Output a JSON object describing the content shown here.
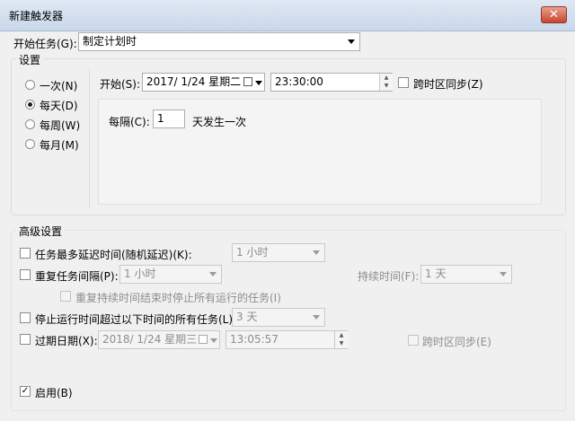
{
  "window": {
    "title": "新建触发器",
    "close_label": "✕"
  },
  "begin_task": {
    "label": "开始任务(G):",
    "value": "制定计划时"
  },
  "settings": {
    "label": "设置",
    "schedule_options": [
      "一次(N)",
      "每天(D)",
      "每周(W)",
      "每月(M)"
    ],
    "selected": "每天(D)",
    "start_label": "开始(S):",
    "start_date": "2017/  1/24 星期二",
    "start_time": "23:30:00",
    "sync_tz_label": "跨时区同步(Z)",
    "recur_label": "每隔(C):",
    "recur_value": "1",
    "recur_suffix": "天发生一次"
  },
  "advanced": {
    "label": "高级设置",
    "delay_label": "任务最多延迟时间(随机延迟)(K):",
    "delay_value": "1 小时",
    "repeat_label": "重复任务间隔(P):",
    "repeat_value": "1 小时",
    "duration_label": "持续时间(F):",
    "duration_value": "1 天",
    "stop_running_label": "重复持续时间结束时停止所有运行的任务(I)",
    "stop_longer_label": "停止运行时间超过以下时间的所有任务(L):",
    "stop_longer_value": "3 天",
    "expire_label": "过期日期(X):",
    "expire_date": "2018/  1/24 星期三",
    "expire_time": "13:05:57",
    "expire_sync_label": "跨时区同步(E)",
    "enabled_label": "启用(B)",
    "enabled_checked": "✓"
  }
}
